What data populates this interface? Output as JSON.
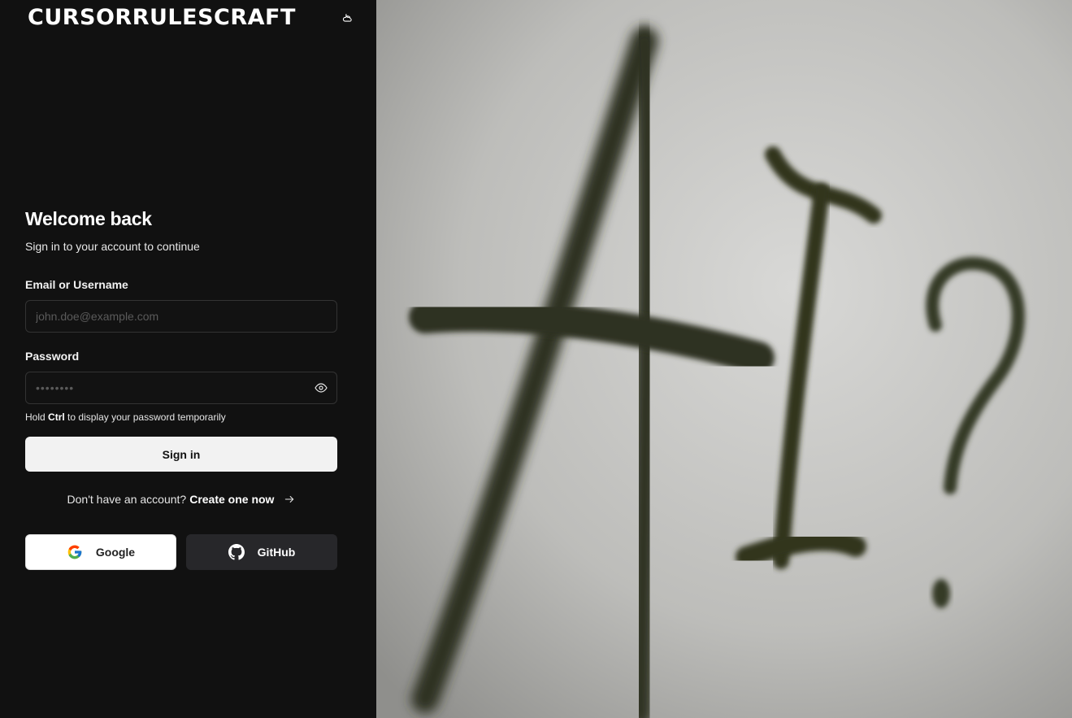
{
  "header": {
    "logo_text": "CURSORRULESCRAFT",
    "theme_toggle_icon": "cloud-moon-icon"
  },
  "form": {
    "title": "Welcome back",
    "subtitle": "Sign in to your account to continue",
    "email_label": "Email or Username",
    "email_placeholder": "john.doe@example.com",
    "email_value": "",
    "password_label": "Password",
    "password_placeholder": "••••••••",
    "password_value": "",
    "hint_prefix": "Hold",
    "hint_key": "Ctrl",
    "hint_suffix": "to display your password temporarily",
    "signin_label": "Sign in",
    "no_account_text": "Don't have an account?",
    "create_link_label": "Create one now"
  },
  "oauth": {
    "google_label": "Google",
    "github_label": "GitHub"
  },
  "colors": {
    "panel_bg": "#111111",
    "signin_bg": "#f2f2f2",
    "github_bg": "#27272a"
  }
}
